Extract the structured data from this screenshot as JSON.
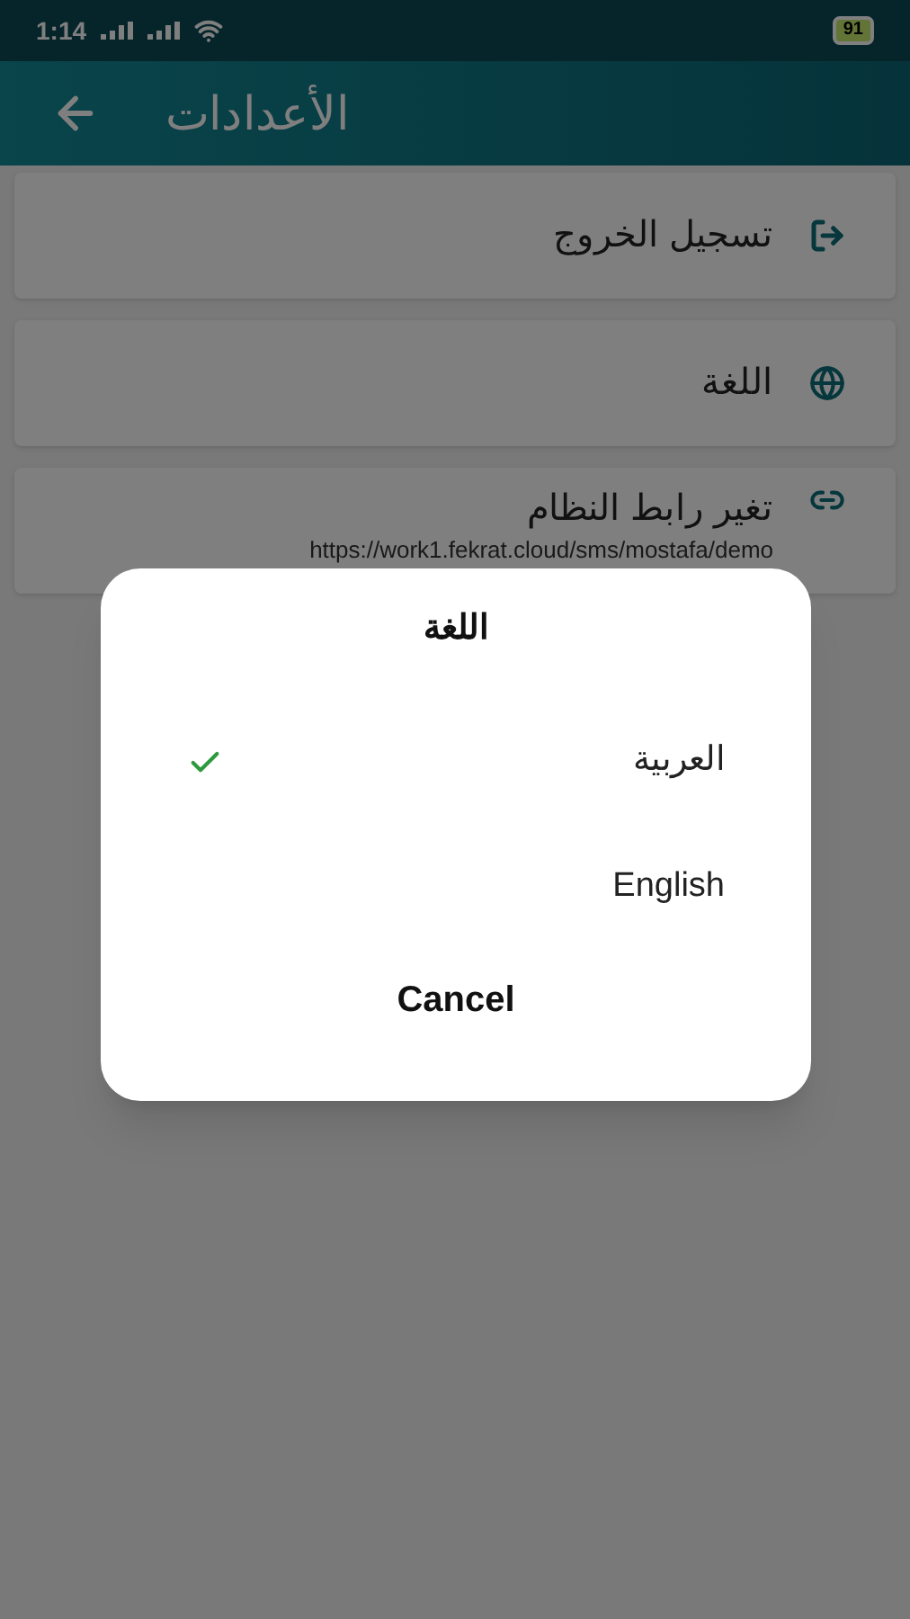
{
  "status_bar": {
    "time": "1:14",
    "battery": "91"
  },
  "app_bar": {
    "title": "الأعدادات"
  },
  "settings": [
    {
      "kind": "logout",
      "label": "تسجيل الخروج"
    },
    {
      "kind": "language",
      "label": "اللغة"
    },
    {
      "kind": "link",
      "label": "تغير رابط النظام",
      "subtitle": "https://work1.fekrat.cloud/sms/mostafa/demo"
    }
  ],
  "dialog": {
    "title": "اللغة",
    "options": [
      {
        "label": "العربية",
        "selected": true
      },
      {
        "label": "English",
        "selected": false
      }
    ],
    "cancel": "Cancel"
  }
}
